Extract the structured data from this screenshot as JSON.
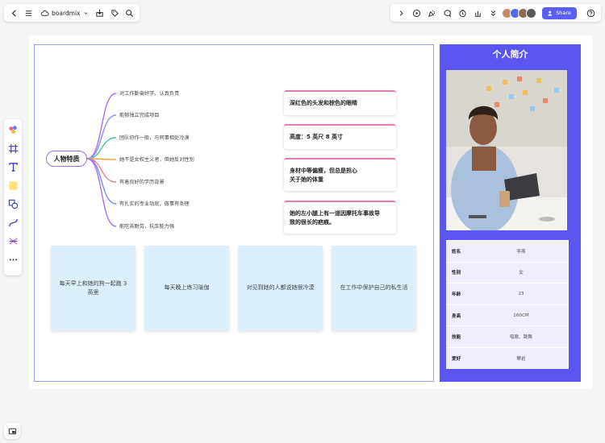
{
  "app": {
    "brand_name": "boardmix"
  },
  "header": {
    "share_label": "Share"
  },
  "mindmap": {
    "root": "人物特质",
    "branches": [
      "对工作勤奋好学、认真负责",
      "能够独立完成项目",
      "团队协作一般，与同事相处冷漠",
      "她不是女权主义者，但她反对性别",
      "有着良好的学历背景",
      "有扎实的专业功底，做事有条理",
      "能吃苦耐劳，抗压能力强"
    ],
    "branch_colors": [
      "#a96ef0",
      "#8f8cf2",
      "#49c2a8",
      "#f5a23d",
      "#e97b9b",
      "#7c8ff0",
      "#a96ef0"
    ]
  },
  "traits": [
    "深红色的头发和棕色的眼睛",
    "高度：5 英尺 8 英寸",
    "身材中等偏瘦，但总是担心\n关于她的体重",
    "她的左小腿上有一道因摩托车事故导\n致的很长的疤痕。"
  ],
  "stickies": [
    "每天早上和她的狗一起跑 3 英里",
    "每天晚上练习瑜伽",
    "对见到她的人都说她很冷漠",
    "在工作中保护自己的私生活"
  ],
  "profile": {
    "title": "个人简介",
    "rows": [
      {
        "key": "姓名",
        "value": "李燕"
      },
      {
        "key": "性别",
        "value": "女"
      },
      {
        "key": "年龄",
        "value": "23"
      },
      {
        "key": "身高",
        "value": "160CM"
      },
      {
        "key": "技能",
        "value": "唱歌、跳舞"
      },
      {
        "key": "爱好",
        "value": "攀岩"
      }
    ]
  },
  "colors": {
    "profile_bg": "#5b55f2",
    "accent": "#5b5ff5",
    "sticky_bg": "#dbeffd",
    "card_border": "#e57cb6"
  }
}
